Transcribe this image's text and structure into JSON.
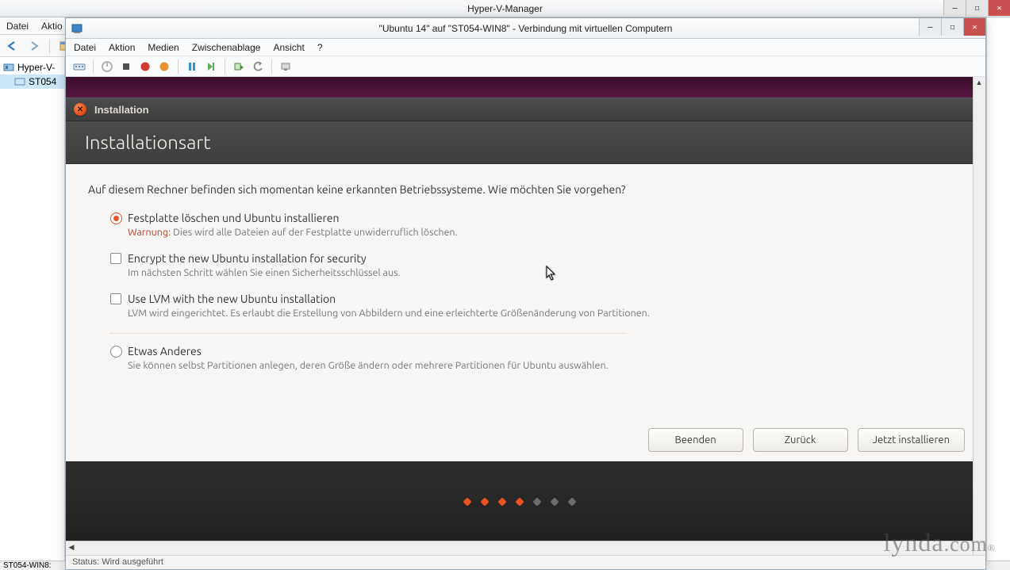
{
  "outer": {
    "title": "Hyper-V-Manager",
    "menu": {
      "file": "Datei",
      "action": "Aktio"
    },
    "tree": {
      "root": "Hyper-V-",
      "node": "ST054"
    },
    "status": "ST054-WIN8:"
  },
  "vmc": {
    "title": "\"Ubuntu 14\" auf \"ST054-WIN8\" - Verbindung mit virtuellen Computern",
    "menu": {
      "file": "Datei",
      "action": "Aktion",
      "media": "Medien",
      "clipboard": "Zwischenablage",
      "view": "Ansicht",
      "help": "?"
    },
    "status": "Status: Wird ausgeführt"
  },
  "ubu": {
    "window_label": "Installation",
    "heading": "Installationsart",
    "intro": "Auf diesem Rechner befinden sich momentan keine erkannten Betriebssysteme. Wie möchten Sie vorgehen?",
    "opt_erase": {
      "label": "Festplatte löschen und Ubuntu installieren",
      "warn_prefix": "Warnung:",
      "warn_text": " Dies wird alle Dateien auf der Festplatte unwiderruflich löschen."
    },
    "opt_encrypt": {
      "label": "Encrypt the new Ubuntu installation for security",
      "desc": "Im nächsten Schritt wählen Sie einen Sicherheitsschlüssel aus."
    },
    "opt_lvm": {
      "label": "Use LVM with the new Ubuntu installation",
      "desc": "LVM wird eingerichtet. Es erlaubt die Erstellung von Abbildern und eine erleichterte Größenänderung von Partitionen."
    },
    "opt_other": {
      "label": "Etwas Anderes",
      "desc": "Sie können selbst Partitionen anlegen, deren Größe ändern oder mehrere Partitionen für Ubuntu auswählen."
    },
    "buttons": {
      "quit": "Beenden",
      "back": "Zurück",
      "install": "Jetzt installieren"
    }
  },
  "watermark": {
    "brand": "lynda",
    "suffix": ".com",
    "reg": "®"
  }
}
